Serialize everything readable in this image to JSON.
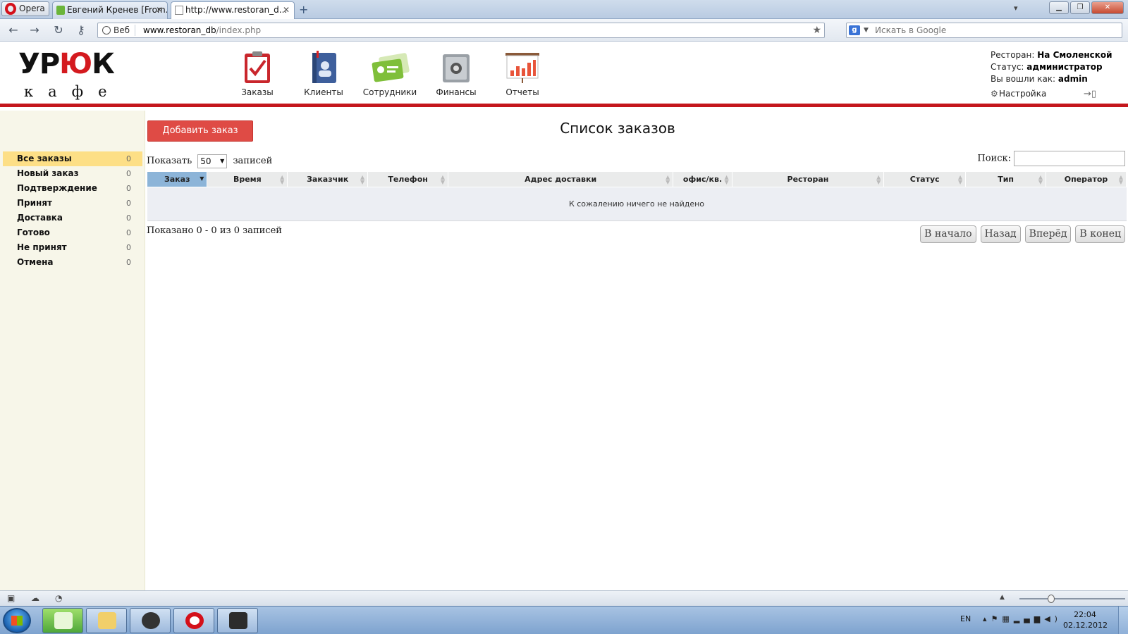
{
  "browser": {
    "opera_label": "Opera",
    "tabs": [
      {
        "label": "Евгений Кренев [From..."
      },
      {
        "label": "http://www.restoran_d..."
      }
    ],
    "address": {
      "zone_label": "Веб",
      "url_host": "www.restoran_db",
      "url_path": "/index.php"
    },
    "search": {
      "placeholder": "Искать в Google"
    }
  },
  "header": {
    "logo_top_a": "УР",
    "logo_top_b": "Ю",
    "logo_top_c": "К",
    "logo_bottom": "кафе",
    "modules": [
      {
        "label": "Заказы",
        "icon": "orders-clipboard-icon"
      },
      {
        "label": "Клиенты",
        "icon": "clients-book-icon"
      },
      {
        "label": "Сотрудники",
        "icon": "staff-badge-icon"
      },
      {
        "label": "Финансы",
        "icon": "finance-safe-icon"
      },
      {
        "label": "Отчеты",
        "icon": "reports-chart-icon"
      }
    ],
    "user": {
      "restaurant_label": "Ресторан:",
      "restaurant_value": "На Смоленской",
      "status_label": "Статус:",
      "status_value": "администратор",
      "login_label": "Вы вошли как:",
      "login_value": "admin",
      "settings_label": "Настройка"
    }
  },
  "sidebar": {
    "items": [
      {
        "label": "Все заказы",
        "count": "0"
      },
      {
        "label": "Новый заказ",
        "count": "0"
      },
      {
        "label": "Подтверждение",
        "count": "0"
      },
      {
        "label": "Принят",
        "count": "0"
      },
      {
        "label": "Доставка",
        "count": "0"
      },
      {
        "label": "Готово",
        "count": "0"
      },
      {
        "label": "Не принят",
        "count": "0"
      },
      {
        "label": "Отмена",
        "count": "0"
      }
    ]
  },
  "main": {
    "add_button": "Добавить заказ",
    "title": "Список заказов",
    "length_prefix": "Показать",
    "length_value": "50",
    "length_suffix": "записей",
    "search_label": "Поиск:",
    "columns": [
      "Заказ",
      "Время",
      "Заказчик",
      "Телефон",
      "Адрес доставки",
      "офис/кв.",
      "Ресторан",
      "Статус",
      "Тип",
      "Оператор"
    ],
    "empty_message": "К сожалению ничего не найдено",
    "info": "Показано 0 - 0 из 0 записей",
    "pager": {
      "first": "В начало",
      "prev": "Назад",
      "next": "Вперёд",
      "last": "В конец"
    }
  },
  "taskbar": {
    "lang": "EN",
    "time": "22:04",
    "date": "02.12.2012"
  },
  "colors": {
    "brand_red": "#c4161c",
    "sidebar_bg": "#f7f6e9",
    "active_item": "#fddf86",
    "sorted_header": "#8cb4d8",
    "add_button": "#df4b45"
  }
}
